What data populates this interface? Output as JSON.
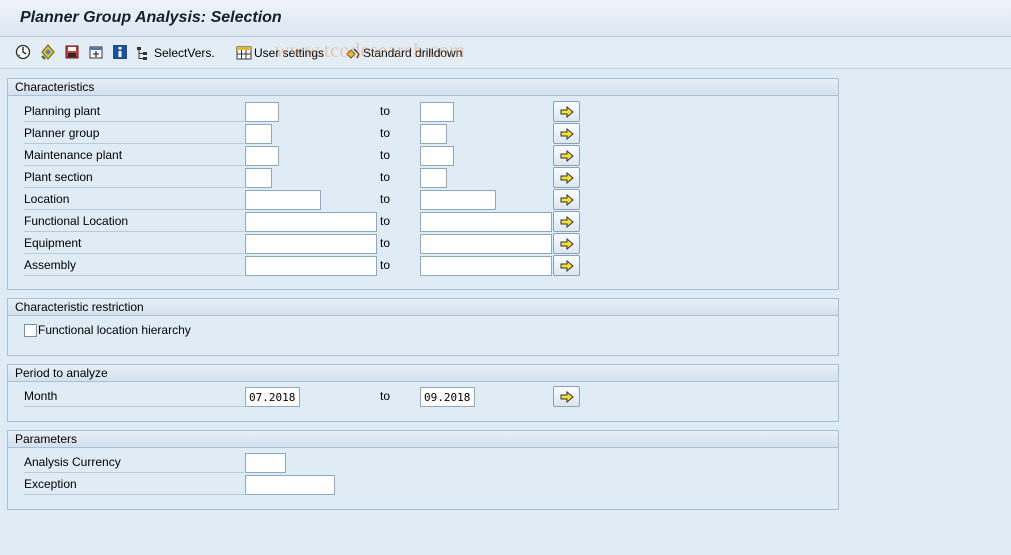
{
  "window": {
    "title": "Planner Group Analysis: Selection"
  },
  "toolbar": {
    "icons": [
      "execute-icon",
      "get-variant-icon",
      "save-variant-icon",
      "expand-icon",
      "info-icon"
    ],
    "select_versions_label": "SelectVers.",
    "user_settings_label": "User settings",
    "standard_drilldown_label": "Standard drilldown",
    "watermark": "www.tcodesearch.com"
  },
  "characteristics": {
    "title": "Characteristics",
    "to_label": "to",
    "rows": [
      {
        "label": "Planning plant",
        "from": "",
        "to": ""
      },
      {
        "label": "Planner group",
        "from": "",
        "to": ""
      },
      {
        "label": "Maintenance plant",
        "from": "",
        "to": ""
      },
      {
        "label": "Plant section",
        "from": "",
        "to": ""
      },
      {
        "label": "Location",
        "from": "",
        "to": ""
      },
      {
        "label": "Functional Location",
        "from": "",
        "to": ""
      },
      {
        "label": "Equipment",
        "from": "",
        "to": ""
      },
      {
        "label": "Assembly",
        "from": "",
        "to": ""
      }
    ]
  },
  "restriction": {
    "title": "Characteristic restriction",
    "checkbox_label": "Functional location hierarchy",
    "checked": false
  },
  "period": {
    "title": "Period to analyze",
    "label": "Month",
    "from": "07.2018",
    "to_label": "to",
    "to": "09.2018"
  },
  "parameters": {
    "title": "Parameters",
    "currency_label": "Analysis Currency",
    "currency_value": "",
    "exception_label": "Exception",
    "exception_value": ""
  },
  "colors": {
    "background": "#dfebf5",
    "arrow": "#f5e03a"
  }
}
